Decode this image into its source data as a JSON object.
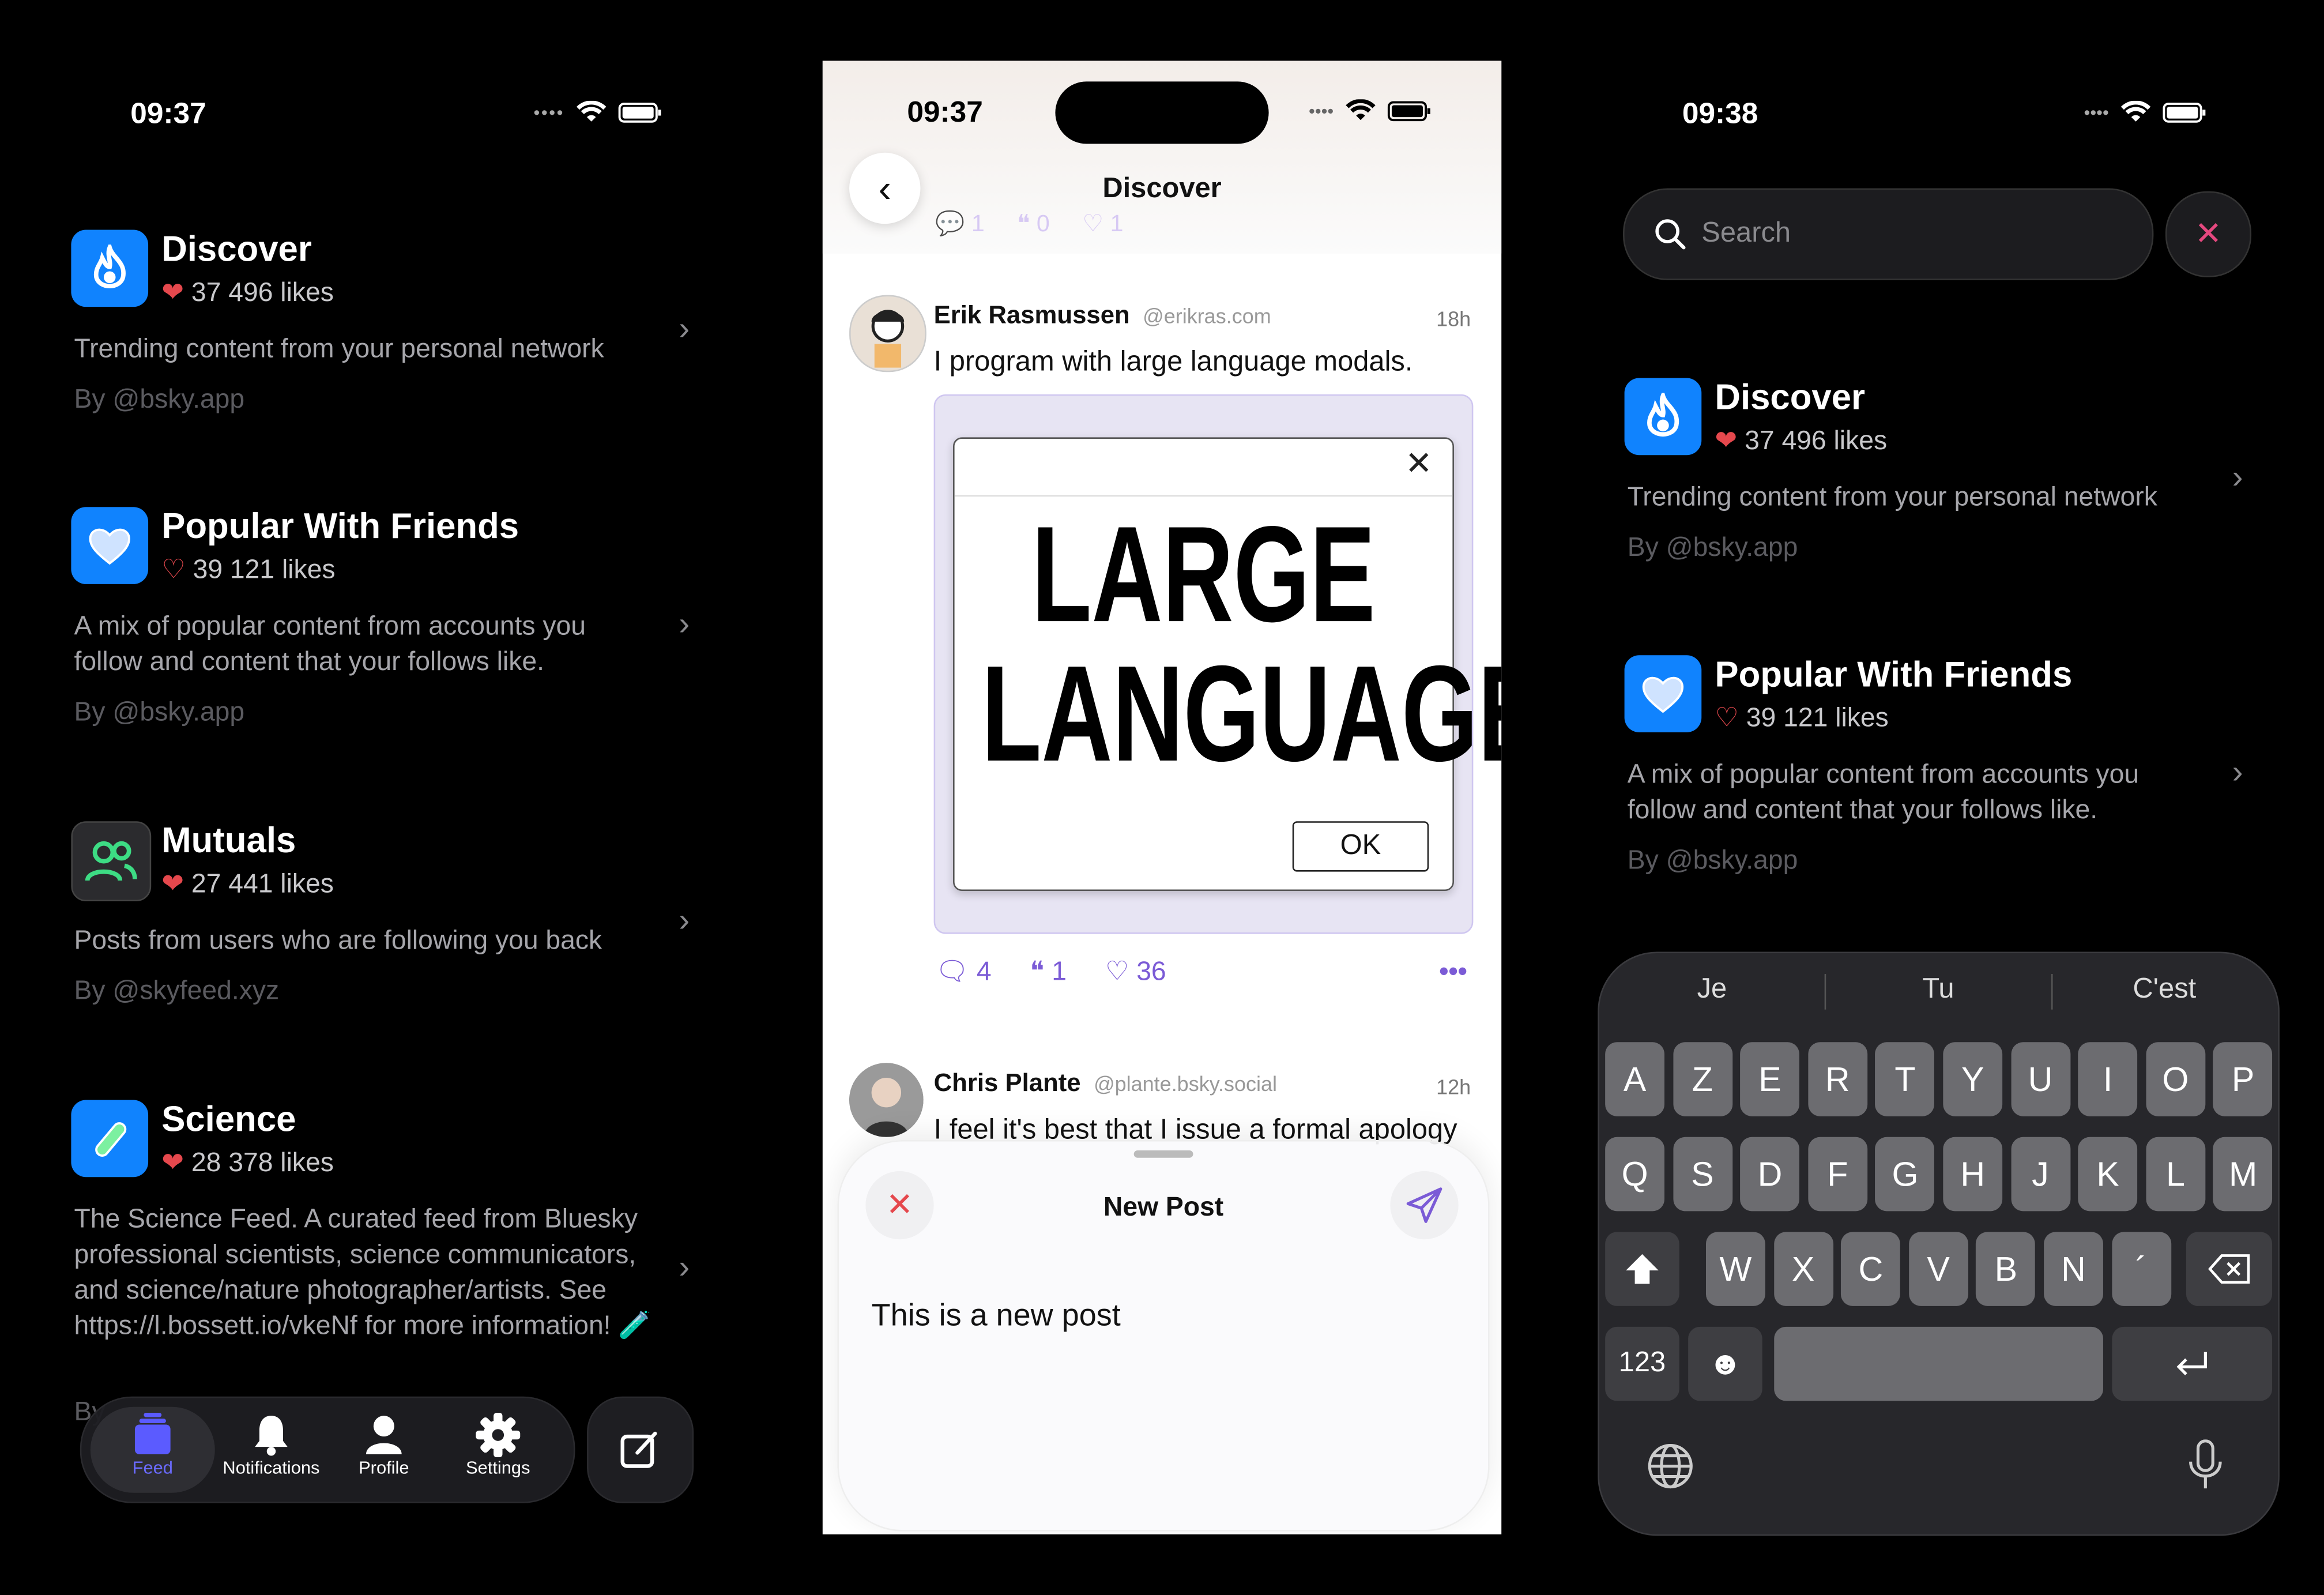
{
  "status": {
    "left_time": "09:37",
    "middle_time": "09:37",
    "right_time": "09:38"
  },
  "feeds": [
    {
      "title": "Discover",
      "likes": "37 496 likes",
      "desc": "Trending content from your personal network",
      "by": "By @bsky.app",
      "icon": "flame-icon",
      "color": "#1083fe"
    },
    {
      "title": "Popular With Friends",
      "likes": "39 121 likes",
      "desc": "A mix of popular content from accounts you follow and content that your follows like.",
      "by": "By @bsky.app",
      "icon": "heart-icon",
      "color": "#1083fe"
    },
    {
      "title": "Mutuals",
      "likes": "27 441 likes",
      "desc": "Posts from users who are following you back",
      "by": "By @skyfeed.xyz",
      "icon": "people-icon",
      "color": "#2b2b2e"
    },
    {
      "title": "Science",
      "likes": "28 378 likes",
      "desc": "The Science Feed. A curated feed from Bluesky professional scientists,  science communicators, and science/nature photographer/artists. See https://l.bossett.io/vkeNf for more information! 🧪",
      "by": "By",
      "icon": "test-tube-icon",
      "color": "#1083fe"
    }
  ],
  "tabbar": {
    "feed": "Feed",
    "notifications": "Notifications",
    "profile": "Profile",
    "settings": "Settings"
  },
  "middle": {
    "title": "Discover",
    "prev_counts": {
      "replies": "1",
      "quotes": "0",
      "likes": "1"
    },
    "post1": {
      "name": "Erik Rasmussen",
      "handle": "@erikras.com",
      "time": "18h",
      "text": "I program with large language modals.",
      "dialog_line1": "LARGE",
      "dialog_line2": "LANGUAGE",
      "dialog_ok": "OK",
      "replies": "4",
      "quotes": "1",
      "likes": "36"
    },
    "post2": {
      "name": "Chris Plante",
      "handle": "@plante.bsky.social",
      "time": "12h",
      "text": "I feel it's best that I issue a formal apology"
    },
    "composer": {
      "title": "New Post",
      "text": "This is a new post"
    }
  },
  "right": {
    "search_placeholder": "Search",
    "suggestions": [
      "Je",
      "Tu",
      "C'est"
    ],
    "row1": [
      "A",
      "Z",
      "E",
      "R",
      "T",
      "Y",
      "U",
      "I",
      "O",
      "P"
    ],
    "row2": [
      "Q",
      "S",
      "D",
      "F",
      "G",
      "H",
      "J",
      "K",
      "L",
      "M"
    ],
    "row3": [
      "W",
      "X",
      "C",
      "V",
      "B",
      "N",
      "´"
    ],
    "numbers_key": "123"
  },
  "colors": {
    "accent": "#1083fe",
    "purple": "#7b5bd6",
    "red_heart": "#e5484d"
  }
}
